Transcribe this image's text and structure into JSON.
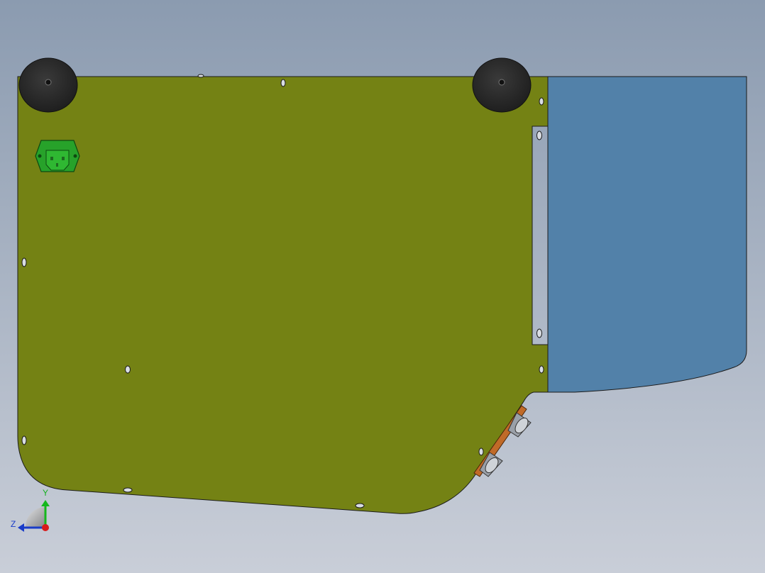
{
  "viewport": {
    "background_top": "#8b9bb0",
    "background_bottom": "#c9ced8"
  },
  "model": {
    "main_panel_color": "#748214",
    "side_panel_color": "#5281a9",
    "foot_color": "#2d2d2d",
    "connector_color": "#27a22a",
    "bracket_color": "#c06a28",
    "edge_color": "#1b1b1b"
  },
  "triad": {
    "y_label": "Y",
    "z_label": "Z",
    "x_color": "#d81b1b",
    "y_color": "#14b81c",
    "z_color": "#1a3cc8"
  }
}
